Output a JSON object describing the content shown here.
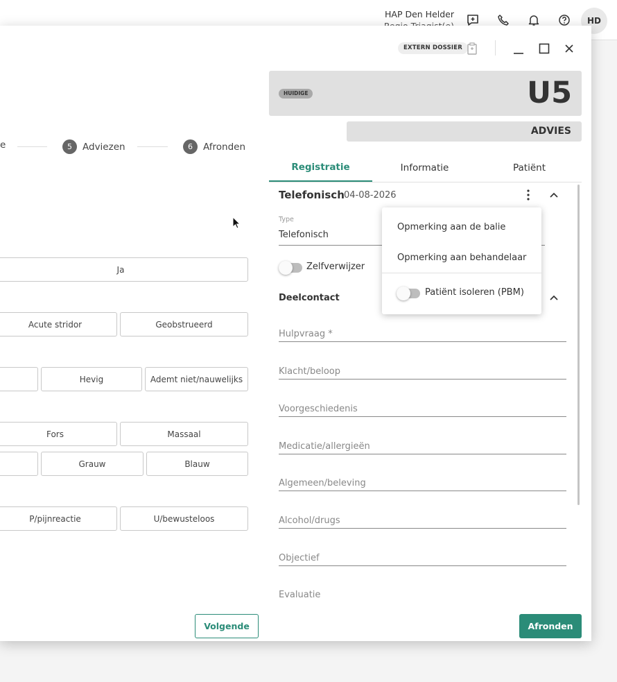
{
  "topbar": {
    "org_name": "HAP Den Helder",
    "org_sub": "Regio Triagist(e)",
    "icons": [
      "add-note-icon",
      "phone-icon",
      "bell-icon",
      "help-icon"
    ],
    "avatar_initials": "HD"
  },
  "dialog": {
    "extern_dossier_label": "EXTERN DOSSIER",
    "icons": [
      "clipboard-icon",
      "minimize-icon",
      "maximize-icon",
      "close-icon"
    ]
  },
  "steps": {
    "partial_label": "e",
    "items": [
      {
        "num": "5",
        "label": "Adviezen"
      },
      {
        "num": "6",
        "label": "Afronden"
      }
    ]
  },
  "options": {
    "row1": [
      "Ja"
    ],
    "row2": [
      "Acute stridor",
      "Geobstrueerd"
    ],
    "row3": [
      "Hevig",
      "Ademt niet/nauwelijks"
    ],
    "row4": [
      "Fors",
      "Massaal"
    ],
    "row5": [
      "Grauw",
      "Blauw"
    ],
    "row6": [
      "P/pijnreactie",
      "U/bewusteloos"
    ]
  },
  "footer": {
    "volgende_label": "Volgende",
    "afronden_label": "Afronden"
  },
  "urgency": {
    "badge": "HUIDIGE",
    "code": "U5",
    "advice": "ADVIES"
  },
  "tabs": [
    {
      "label": "Registratie",
      "active": true
    },
    {
      "label": "Informatie",
      "active": false
    },
    {
      "label": "Patiënt",
      "active": false
    }
  ],
  "registration": {
    "title": "Telefonisch",
    "date": "04-08-2026",
    "type_label": "Type",
    "type_value": "Telefonisch",
    "zelfverwijzer_label": "Zelfverwijzer",
    "deelcontact_label": "Deelcontact",
    "fields": [
      "Hulpvraag *",
      "Klacht/beloop",
      "Voorgeschiedenis",
      "Medicatie/allergieën",
      "Algemeen/beleving",
      "Alcohol/drugs",
      "Objectief",
      "Evaluatie"
    ]
  },
  "menu": {
    "items": [
      "Opmerking aan de balie",
      "Opmerking aan behandelaar"
    ],
    "toggle_label": "Patiënt isoleren (PBM)"
  },
  "colors": {
    "accent": "#2b8c78",
    "panel_grey": "#e0e0e0"
  }
}
